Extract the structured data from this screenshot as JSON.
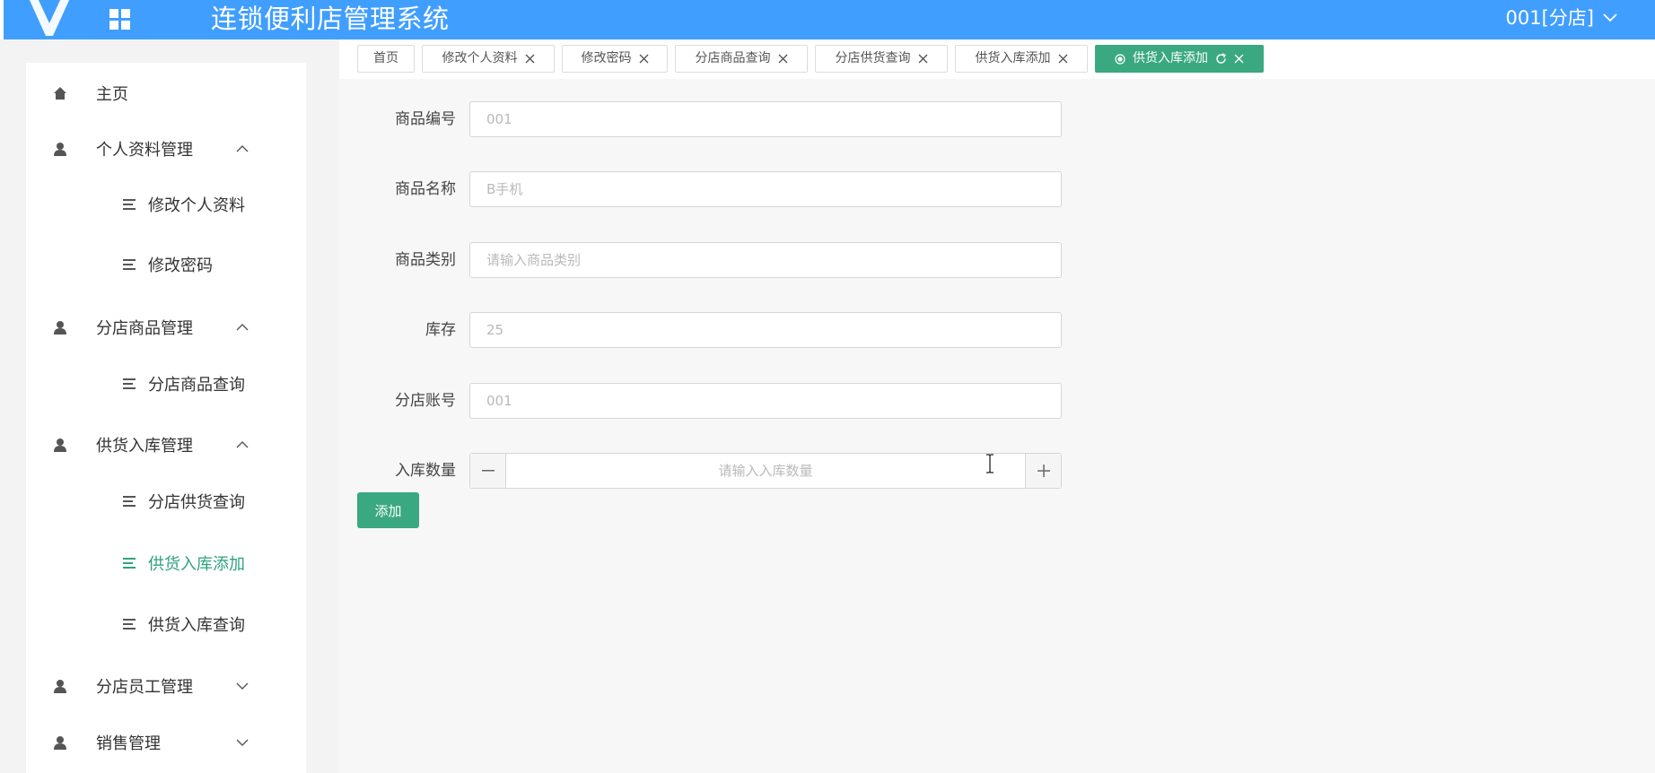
{
  "header": {
    "title": "连锁便利店管理系统",
    "user": "001[分店]",
    "bg_color": "#409eff"
  },
  "sidebar": {
    "items": [
      {
        "label": "主页",
        "icon": "home-icon"
      },
      {
        "label": "个人资料管理",
        "icon": "user-icon",
        "expanded": true
      },
      {
        "label": "修改个人资料",
        "icon": "list-icon"
      },
      {
        "label": "修改密码",
        "icon": "list-icon"
      },
      {
        "label": "分店商品管理",
        "icon": "user-icon",
        "expanded": true
      },
      {
        "label": "分店商品查询",
        "icon": "list-icon"
      },
      {
        "label": "供货入库管理",
        "icon": "user-icon",
        "expanded": true
      },
      {
        "label": "分店供货查询",
        "icon": "list-icon"
      },
      {
        "label": "供货入库添加",
        "icon": "list-icon",
        "active": true
      },
      {
        "label": "供货入库查询",
        "icon": "list-icon"
      },
      {
        "label": "分店员工管理",
        "icon": "user-icon",
        "expanded": false
      },
      {
        "label": "销售管理",
        "icon": "user-icon",
        "expanded": false
      }
    ],
    "active_color": "#2fa17f"
  },
  "tabs": [
    {
      "label": "首页"
    },
    {
      "label": "修改个人资料"
    },
    {
      "label": "修改密码"
    },
    {
      "label": "分店商品查询"
    },
    {
      "label": "分店供货查询"
    },
    {
      "label": "供货入库添加"
    },
    {
      "label": "供货入库添加",
      "active": true
    }
  ],
  "form": {
    "fields": [
      {
        "label": "商品编号",
        "placeholder": "001"
      },
      {
        "label": "商品名称",
        "placeholder": "B手机"
      },
      {
        "label": "商品类别",
        "placeholder": "请输入商品类别"
      },
      {
        "label": "库存",
        "placeholder": "25"
      },
      {
        "label": "分店账号",
        "placeholder": "001"
      }
    ],
    "quantity": {
      "label": "入库数量",
      "placeholder": "请输入入库数量"
    },
    "submit_label": "添加",
    "accent_color": "#3aa881"
  }
}
